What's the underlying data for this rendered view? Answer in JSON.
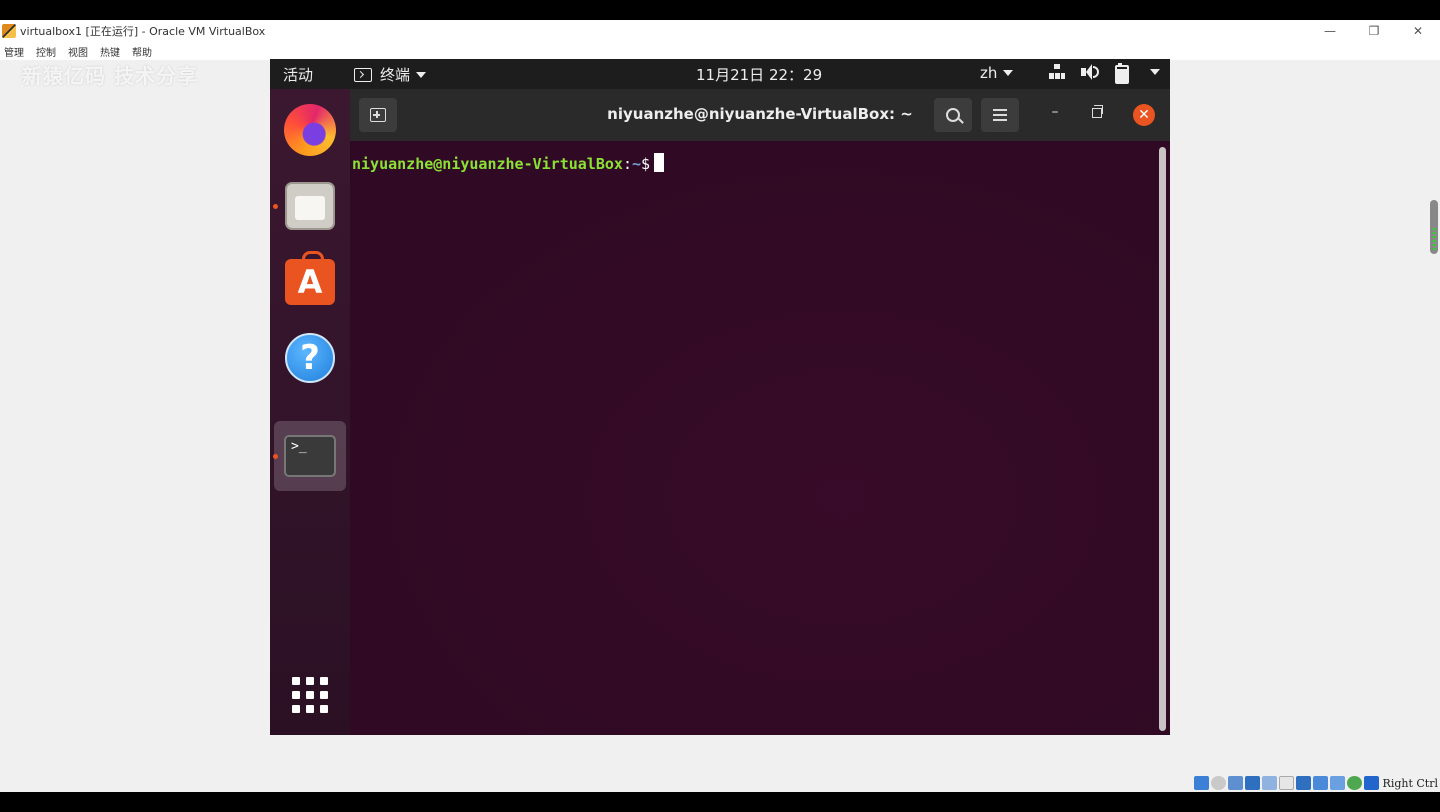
{
  "host": {
    "title": "virtualbox1 [正在运行] - Oracle VM VirtualBox",
    "controls": {
      "minimize": "—",
      "restore": "❐",
      "close": "✕"
    },
    "menu": [
      "管理",
      "控制",
      "视图",
      "热键",
      "帮助"
    ],
    "watermark": "新猿亿码 技术分享",
    "status_hostkey": "Right Ctrl"
  },
  "guest": {
    "topbar": {
      "activities": "活动",
      "app_name": "终端",
      "clock": "11月21日 22：29",
      "lang": "zh"
    },
    "dock": {
      "items": [
        {
          "name": "firefox",
          "running": false
        },
        {
          "name": "files",
          "running": true
        },
        {
          "name": "software",
          "running": false
        },
        {
          "name": "help",
          "running": false
        },
        {
          "name": "terminal",
          "running": true,
          "active": true
        }
      ],
      "terminal_glyph": ">_",
      "store_glyph": "A",
      "help_glyph": "?"
    },
    "terminal": {
      "title": "niyuanzhe@niyuanzhe-VirtualBox: ~",
      "prompt_user": "niyuanzhe@niyuanzhe-VirtualBox",
      "prompt_sep": ":",
      "prompt_path": "~",
      "prompt_symbol": "$",
      "min_glyph": "–",
      "close_glyph": "✕"
    }
  },
  "colors": {
    "ubuntu_orange": "#e95420",
    "terminal_bg": "#300a24",
    "prompt_green": "#8ae234",
    "prompt_blue": "#729fcf"
  }
}
